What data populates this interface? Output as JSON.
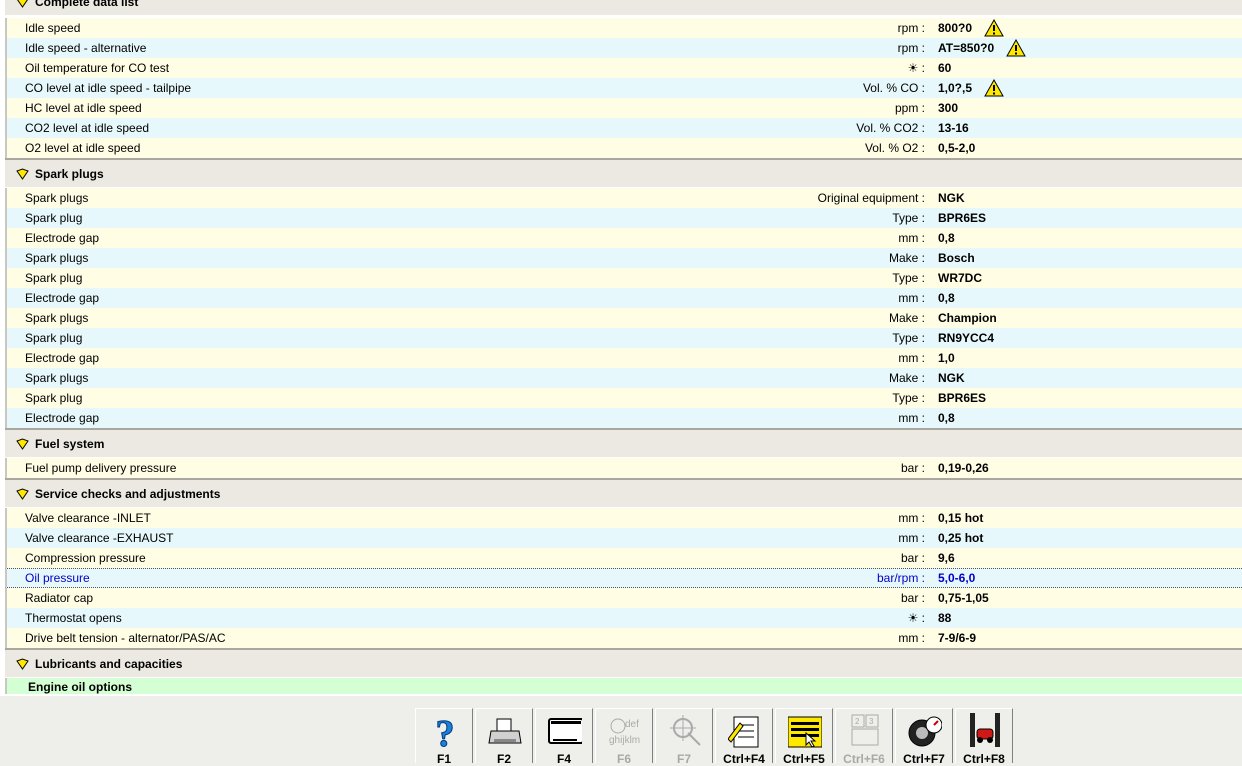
{
  "colors": {
    "row_odd": "#fffde3",
    "row_even": "#e6f8fb",
    "header": "#ebe9e1",
    "subsection": "#d4ffd4",
    "selected_text": "#0000c8"
  },
  "top_section": {
    "title": "Complete data list"
  },
  "idle_rows": [
    {
      "label": "Idle speed",
      "unit": "rpm :",
      "value": "800?0",
      "warn": true
    },
    {
      "label": "Idle speed - alternative",
      "unit": "rpm :",
      "value": "AT=850?0",
      "warn": true
    },
    {
      "label": "Oil temperature for CO test",
      "unit": "☀ :",
      "value": "60",
      "warn": false
    },
    {
      "label": "CO level at idle speed - tailpipe",
      "unit": "Vol. % CO :",
      "value": "1,0?,5",
      "warn": true
    },
    {
      "label": "HC level at idle speed",
      "unit": "ppm :",
      "value": "300",
      "warn": false
    },
    {
      "label": "CO2 level at idle speed",
      "unit": "Vol. % CO2 :",
      "value": "13-16",
      "warn": false
    },
    {
      "label": "O2 level at idle speed",
      "unit": "Vol. % O2 :",
      "value": "0,5-2,0",
      "warn": false
    }
  ],
  "spark": {
    "title": "Spark plugs",
    "rows": [
      {
        "label": "Spark plugs",
        "unit": "Original equipment :",
        "value": "NGK"
      },
      {
        "label": "Spark plug",
        "unit": "Type :",
        "value": "BPR6ES"
      },
      {
        "label": "Electrode gap",
        "unit": "mm :",
        "value": "0,8"
      },
      {
        "label": "Spark plugs",
        "unit": "Make :",
        "value": "Bosch"
      },
      {
        "label": "Spark plug",
        "unit": "Type :",
        "value": "WR7DC"
      },
      {
        "label": "Electrode gap",
        "unit": "mm :",
        "value": "0,8"
      },
      {
        "label": "Spark plugs",
        "unit": "Make :",
        "value": "Champion"
      },
      {
        "label": "Spark plug",
        "unit": "Type :",
        "value": "RN9YCC4"
      },
      {
        "label": "Electrode gap",
        "unit": "mm :",
        "value": "1,0"
      },
      {
        "label": "Spark plugs",
        "unit": "Make :",
        "value": "NGK"
      },
      {
        "label": "Spark plug",
        "unit": "Type :",
        "value": "BPR6ES"
      },
      {
        "label": "Electrode gap",
        "unit": "mm :",
        "value": "0,8"
      }
    ]
  },
  "fuel": {
    "title": "Fuel system",
    "rows": [
      {
        "label": "Fuel pump delivery pressure",
        "unit": "bar :",
        "value": "0,19-0,26"
      }
    ]
  },
  "service": {
    "title": "Service checks and adjustments",
    "rows": [
      {
        "label": "Valve clearance  -INLET",
        "unit": "mm :",
        "value": "0,15 hot"
      },
      {
        "label": "Valve clearance  -EXHAUST",
        "unit": "mm :",
        "value": "0,25 hot"
      },
      {
        "label": "Compression pressure",
        "unit": "bar :",
        "value": "9,6"
      },
      {
        "label": "Oil pressure",
        "unit": "bar/rpm :",
        "value": "5,0-6,0",
        "selected": true
      },
      {
        "label": "Radiator cap",
        "unit": "bar :",
        "value": "0,75-1,05"
      },
      {
        "label": "Thermostat opens",
        "unit": "☀ :",
        "value": "88"
      },
      {
        "label": "Drive belt tension - alternator/PAS/AC",
        "unit": "mm :",
        "value": "7-9/6-9"
      }
    ]
  },
  "lubricants": {
    "title": "Lubricants and capacities",
    "sub": "Engine oil options"
  },
  "toolbar": [
    {
      "key": "F1",
      "icon": "help-icon",
      "enabled": true
    },
    {
      "key": "F2",
      "icon": "printer-icon",
      "enabled": true
    },
    {
      "key": "F4",
      "icon": "window-icon",
      "enabled": true
    },
    {
      "key": "F6",
      "icon": "text-search-icon",
      "enabled": false
    },
    {
      "key": "F7",
      "icon": "crosshair-icon",
      "enabled": false
    },
    {
      "key": "Ctrl+F4",
      "icon": "note-edit-icon",
      "enabled": true
    },
    {
      "key": "Ctrl+F5",
      "icon": "list-pointer-icon",
      "enabled": true
    },
    {
      "key": "Ctrl+F6",
      "icon": "grid-icon",
      "enabled": false
    },
    {
      "key": "Ctrl+F7",
      "icon": "gauge-icon",
      "enabled": true
    },
    {
      "key": "Ctrl+F8",
      "icon": "car-lift-icon",
      "enabled": true
    }
  ]
}
